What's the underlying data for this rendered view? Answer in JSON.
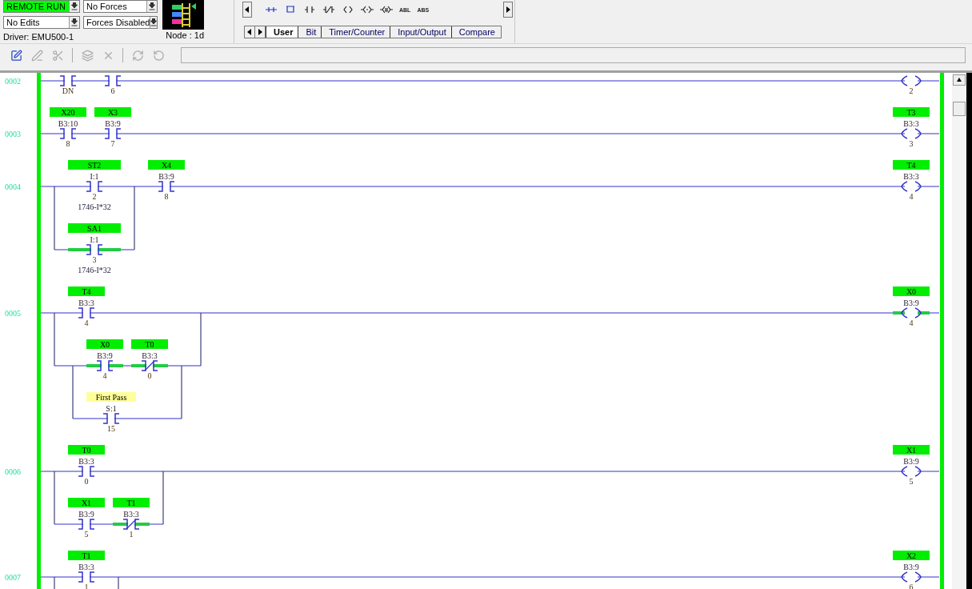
{
  "status": {
    "mode": "REMOTE RUN",
    "forces": "No Forces",
    "edits": "No Edits",
    "force_state": "Forces Disabled",
    "driver": "Driver:  EMU500-1",
    "node": "Node :  1d"
  },
  "palette": {
    "text_buttons": [
      "ABL",
      "ABS"
    ]
  },
  "palette_tabs": [
    {
      "label": "User",
      "selected": true
    },
    {
      "label": "Bit",
      "selected": false
    },
    {
      "label": "Timer/Counter",
      "selected": false
    },
    {
      "label": "Input/Output",
      "selected": false
    },
    {
      "label": "Compare",
      "selected": false
    }
  ],
  "rungs": [
    {
      "number": "0002",
      "series": [
        {
          "kind": "xic",
          "bit": "DN",
          "energized": false
        },
        {
          "kind": "xic",
          "bit": "6",
          "energized": false
        }
      ],
      "output": {
        "kind": "ote",
        "bit": "2",
        "energized": false
      }
    },
    {
      "number": "0003",
      "series": [
        {
          "kind": "xic",
          "tag": "X20",
          "color": "#00ee00",
          "address": "B3:10",
          "bit": "8",
          "energized": false
        },
        {
          "kind": "xic",
          "tag": "X3",
          "color": "#00ee00",
          "address": "B3:9",
          "bit": "7",
          "energized": false
        }
      ],
      "output": {
        "kind": "ote",
        "tag": "T3",
        "color": "#00ee00",
        "address": "B3:3",
        "bit": "3",
        "energized": false
      }
    },
    {
      "number": "0004",
      "series": [
        {
          "kind": "branch",
          "rows": [
            [
              {
                "kind": "xic",
                "tag": "ST2",
                "color": "#00ee00",
                "address": "I:1",
                "bit": "2",
                "description": "1746-I*32",
                "energized": false
              }
            ],
            [
              {
                "kind": "xic",
                "tag": "SA1",
                "color": "#00ee00",
                "address": "I:1",
                "bit": "3",
                "description": "1746-I*32",
                "energized": true
              }
            ]
          ]
        },
        {
          "kind": "xic",
          "tag": "X4",
          "color": "#00ee00",
          "address": "B3:9",
          "bit": "8",
          "energized": false
        }
      ],
      "output": {
        "kind": "ote",
        "tag": "T4",
        "color": "#00ee00",
        "address": "B3:3",
        "bit": "4",
        "energized": false
      }
    },
    {
      "number": "0005",
      "series": [
        {
          "kind": "branch",
          "rows": [
            [
              {
                "kind": "xic",
                "tag": "T4",
                "color": "#00ee00",
                "address": "B3:3",
                "bit": "4",
                "energized": false
              }
            ],
            [
              {
                "kind": "branch",
                "rows": [
                  [
                    {
                      "kind": "xic",
                      "tag": "X0",
                      "color": "#00ee00",
                      "address": "B3:9",
                      "bit": "4",
                      "energized": true
                    },
                    {
                      "kind": "xio",
                      "tag": "T0",
                      "color": "#00ee00",
                      "address": "B3:3",
                      "bit": "0",
                      "energized": true
                    }
                  ],
                  [
                    {
                      "kind": "xic",
                      "tag": "First Pass",
                      "color": "#ffff99",
                      "address": "S:1",
                      "bit": "15",
                      "energized": false
                    }
                  ]
                ]
              }
            ]
          ]
        }
      ],
      "output": {
        "kind": "ote",
        "tag": "X0",
        "color": "#00ee00",
        "address": "B3:9",
        "bit": "4",
        "energized": true
      }
    },
    {
      "number": "0006",
      "series": [
        {
          "kind": "branch",
          "rows": [
            [
              {
                "kind": "xic",
                "tag": "T0",
                "color": "#00ee00",
                "address": "B3:3",
                "bit": "0",
                "energized": false
              }
            ],
            [
              {
                "kind": "xic",
                "tag": "X1",
                "color": "#00ee00",
                "address": "B3:9",
                "bit": "5",
                "energized": false
              },
              {
                "kind": "xio",
                "tag": "T1",
                "color": "#00ee00",
                "address": "B3:3",
                "bit": "1",
                "energized": true
              }
            ]
          ]
        }
      ],
      "output": {
        "kind": "ote",
        "tag": "X1",
        "color": "#00ee00",
        "address": "B3:9",
        "bit": "5",
        "energized": false
      }
    },
    {
      "number": "0007",
      "series": [
        {
          "kind": "branch",
          "rows": [
            [
              {
                "kind": "xic",
                "tag": "T1",
                "color": "#00ee00",
                "address": "B3:3",
                "bit": "1",
                "energized": false
              }
            ]
          ]
        }
      ],
      "output": {
        "kind": "ote",
        "tag": "X2",
        "color": "#00ee00",
        "address": "B3:9",
        "bit": "6",
        "energized": false
      }
    }
  ]
}
